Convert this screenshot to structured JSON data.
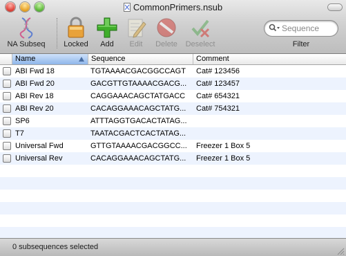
{
  "window": {
    "title": "CommonPrimers.nsub"
  },
  "toolbar": {
    "items": [
      {
        "label": "NA Subseq",
        "icon": "na-subseq-icon",
        "enabled": true
      },
      {
        "label": "Locked",
        "icon": "lock-icon",
        "enabled": true
      },
      {
        "label": "Add",
        "icon": "plus-icon",
        "enabled": true
      },
      {
        "label": "Edit",
        "icon": "pencil-icon",
        "enabled": false
      },
      {
        "label": "Delete",
        "icon": "no-entry-icon",
        "enabled": false
      },
      {
        "label": "Deselect",
        "icon": "deselect-icon",
        "enabled": false
      }
    ],
    "search": {
      "placeholder": "Sequence",
      "value": ""
    },
    "filter_label": "Filter"
  },
  "table": {
    "columns": [
      {
        "label": "Name",
        "sorted": true,
        "direction": "ascending"
      },
      {
        "label": "Sequence"
      },
      {
        "label": "Comment"
      }
    ],
    "rows": [
      {
        "name": "ABI Fwd 18",
        "sequence": "TGTAAAACGACGGCCAGT",
        "comment": "Cat# 123456",
        "checked": false
      },
      {
        "name": "ABI Fwd 20",
        "sequence": "GACGTTGTAAAACGACG...",
        "comment": "Cat# 123457",
        "checked": false
      },
      {
        "name": "ABI Rev 18",
        "sequence": "CAGGAAACAGCTATGACC",
        "comment": "Cat# 654321",
        "checked": false
      },
      {
        "name": "ABI Rev 20",
        "sequence": "CACAGGAAACAGCTATG...",
        "comment": "Cat# 754321",
        "checked": false
      },
      {
        "name": "SP6",
        "sequence": "ATTTAGGTGACACTATAG...",
        "comment": "",
        "checked": false
      },
      {
        "name": "T7",
        "sequence": "TAATACGACTCACTATAG...",
        "comment": "",
        "checked": false
      },
      {
        "name": "Universal Fwd",
        "sequence": "GTTGTAAAACGACGGCC...",
        "comment": "Freezer 1 Box 5",
        "checked": false
      },
      {
        "name": "Universal Rev",
        "sequence": "CACAGGAAACAGCTATG...",
        "comment": "Freezer 1 Box 5",
        "checked": false
      }
    ]
  },
  "status": {
    "text": "0 subsequences selected"
  },
  "colors": {
    "row_stripe": "#edf3fe",
    "sorted_header": "#8fb6ea",
    "add_green": "#3fae2a",
    "delete_red": "#d33a33"
  }
}
